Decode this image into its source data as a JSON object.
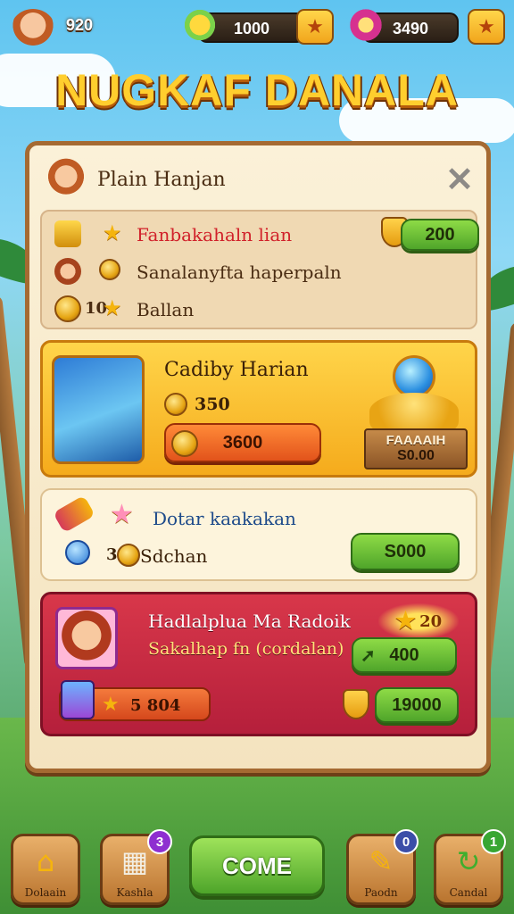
{
  "colors": {
    "accent_gold": "#ffce2e",
    "panel_bg": "#fbf1d8",
    "red_card": "#c82a42",
    "green_button": "#5fb832"
  },
  "topbar": {
    "level": "920",
    "currency_1": "1000",
    "currency_2": "3490",
    "icons": [
      "avatar",
      "gem-cluster-icon",
      "star-button-icon",
      "magnet-icon",
      "star-button-icon"
    ]
  },
  "title": "NUGKAF DANALA",
  "panel": {
    "header_title": "Plain Hanjan",
    "quests": [
      {
        "text": "Fanbakahaln lian",
        "num": ""
      },
      {
        "text": "Sanalanyfta haperpaln",
        "num": ""
      },
      {
        "text": "Ballan",
        "num": "10"
      }
    ],
    "quest_reward": "200",
    "gold_card": {
      "title": "Cadiby Harian",
      "amount": "350",
      "button": "3600",
      "banner_top": "FAAAAIH",
      "banner_bottom": "S0.00"
    },
    "cream_card": {
      "title": "Dotar kaakakan",
      "count": "3",
      "subtitle": "Sdchan",
      "button": "S000"
    },
    "red_card": {
      "title": "Hadlalplua Ma Radoik",
      "subtitle": "Sakalhap fn (cordalan)",
      "badge": "20",
      "button_1": "400",
      "pill_value": "5 804",
      "button_2": "19000"
    }
  },
  "bottom_nav": {
    "items": [
      {
        "label": "Dolaain",
        "glyph": "⌂",
        "badge": ""
      },
      {
        "label": "Kashla",
        "glyph": "▦",
        "badge": "3"
      },
      {
        "label": "Paodn",
        "glyph": "✎",
        "badge": "0"
      },
      {
        "label": "Candal",
        "glyph": "↻",
        "badge": "1"
      }
    ],
    "center_label": "COME"
  }
}
